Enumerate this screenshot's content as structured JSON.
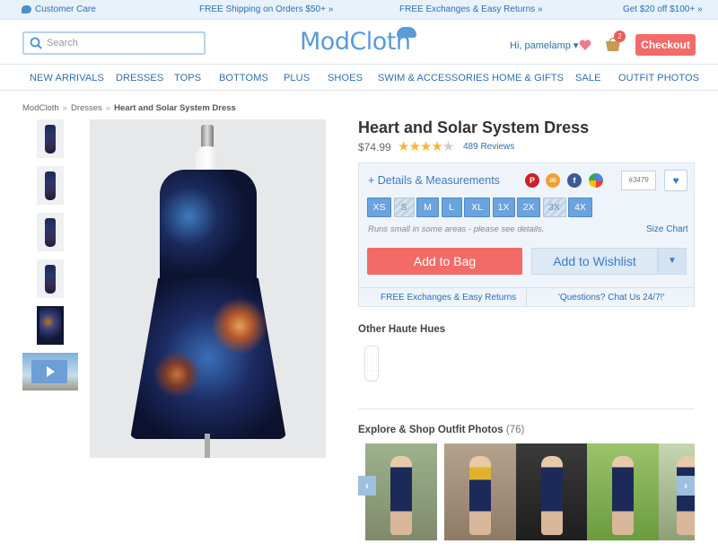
{
  "promo": {
    "customer_care": "Customer Care",
    "shipping": "FREE Shipping on Orders $50+ »",
    "returns": "FREE Exchanges & Easy Returns »",
    "gift": "Get $20 off $100+ »"
  },
  "header": {
    "search_placeholder": "Search",
    "logo": "ModCloth",
    "user_greeting": "Hi, pamelamp ▾",
    "cart_count": "2",
    "checkout_label": "Checkout"
  },
  "nav": {
    "items": [
      "NEW ARRIVALS",
      "DRESSES",
      "TOPS",
      "BOTTOMS",
      "PLUS",
      "SHOES",
      "SWIM & ACCESSORIES",
      "HOME & GIFTS",
      "SALE",
      "OUTFIT PHOTOS"
    ]
  },
  "breadcrumb": {
    "items": [
      "ModCloth",
      "Dresses",
      "Heart and Solar System Dress"
    ],
    "separator": "»"
  },
  "product": {
    "title": "Heart and Solar System Dress",
    "price": "$74.99",
    "rating": 4,
    "rating_max": 5,
    "reviews": "489 Reviews",
    "details_label": "+ Details & Measurements",
    "sku": "#3479",
    "sizes": [
      {
        "label": "XS",
        "available": true
      },
      {
        "label": "S",
        "available": false
      },
      {
        "label": "M",
        "available": true
      },
      {
        "label": "L",
        "available": true
      },
      {
        "label": "XL",
        "available": true
      },
      {
        "label": "1X",
        "available": true
      },
      {
        "label": "2X",
        "available": true
      },
      {
        "label": "3X",
        "available": false
      },
      {
        "label": "4X",
        "available": true
      }
    ],
    "fit_note": "Runs small in some areas - please see details.",
    "size_chart": "Size Chart",
    "add_to_bag": "Add to Bag",
    "add_to_wishlist": "Add to Wishlist",
    "free_returns": "FREE Exchanges & Easy Returns",
    "questions": "'Questions? Chat Us 24/7!'"
  },
  "social": {
    "pinterest": "P",
    "email": "✉",
    "facebook": "f"
  },
  "other_hues": {
    "title": "Other Haute Hues"
  },
  "explore": {
    "title": "Explore & Shop Outfit Photos",
    "count": "(76)"
  },
  "colors": {
    "accent_blue": "#2d6fb3",
    "checkout_red": "#f26b67",
    "size_blue": "#6aa3dd",
    "star_gold": "#f2b73d"
  }
}
